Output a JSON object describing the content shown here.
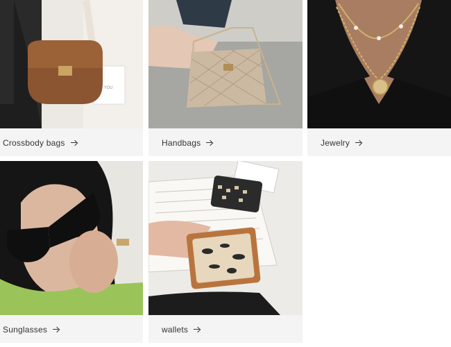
{
  "collections": [
    {
      "label": "Crossbody bags",
      "image": "crossbody-bag-photo"
    },
    {
      "label": "Handbags",
      "image": "quilted-handbag-photo"
    },
    {
      "label": "Jewelry",
      "image": "necklace-photo"
    },
    {
      "label": "Sunglasses",
      "image": "sunglasses-photo"
    },
    {
      "label": "wallets",
      "image": "wallets-photo"
    }
  ],
  "icons": {
    "arrow": "arrow-right-icon"
  },
  "colors": {
    "card_bg": "#f4f4f4",
    "text": "#333333"
  }
}
